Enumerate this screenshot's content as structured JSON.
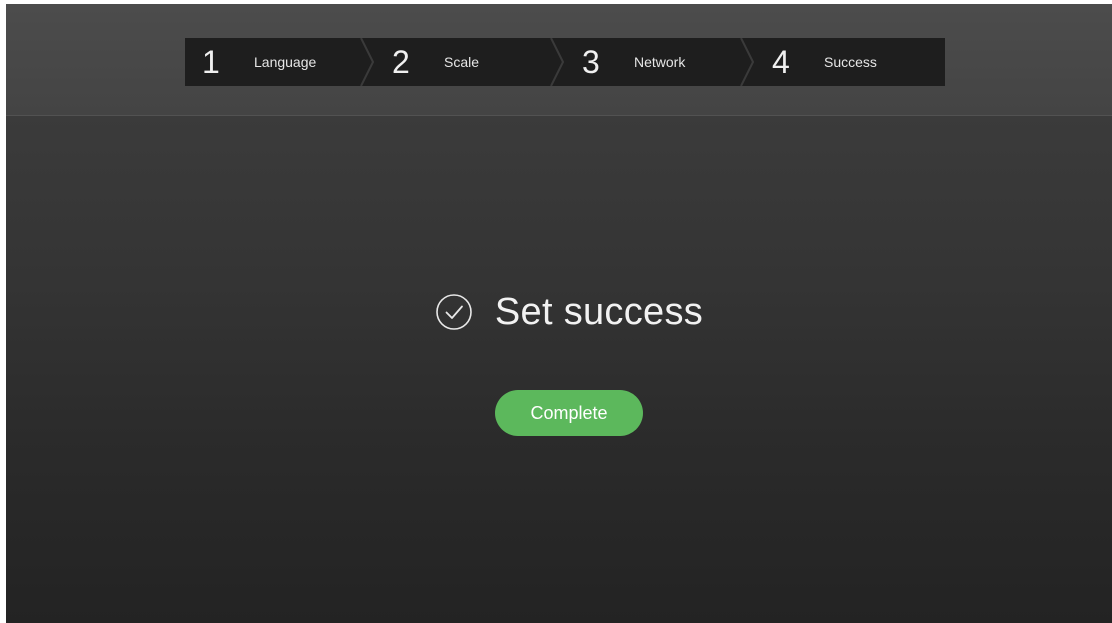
{
  "stepper": {
    "steps": [
      {
        "number": "1",
        "label": "Language"
      },
      {
        "number": "2",
        "label": "Scale"
      },
      {
        "number": "3",
        "label": "Network"
      },
      {
        "number": "4",
        "label": "Success"
      }
    ]
  },
  "main": {
    "status_icon": "check-circle-icon",
    "status_text": "Set success",
    "complete_label": "Complete"
  },
  "colors": {
    "accent_green": "#5cb85c",
    "background": "#333333",
    "stepper_background": "#1e1e1e"
  }
}
